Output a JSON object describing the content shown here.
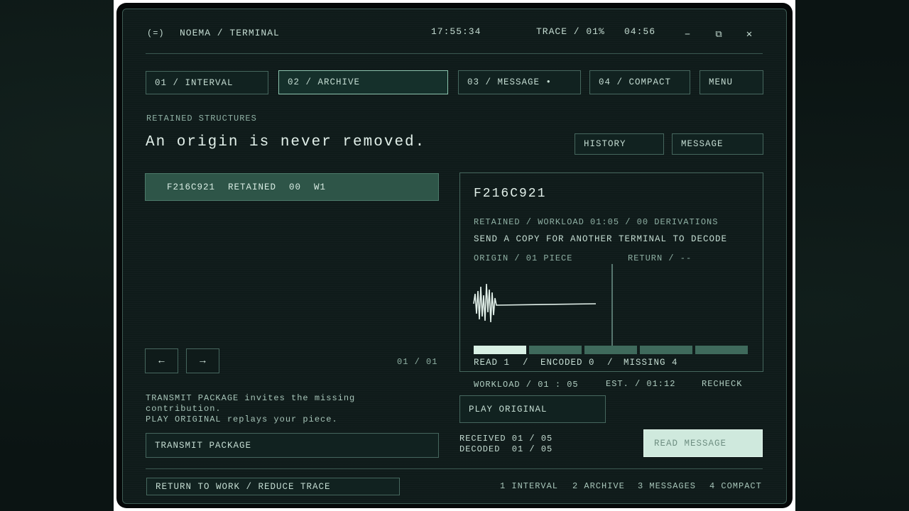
{
  "window": {
    "icon_glyph": "(=)",
    "title": "NOEMA / TERMINAL",
    "clock": "17:55:34",
    "trace": "TRACE / 01%",
    "timer": "04:56",
    "minimize_glyph": "–",
    "restore_glyph": "⧉",
    "close_glyph": "✕"
  },
  "tabs": [
    {
      "label": "01 / INTERVAL",
      "active": false
    },
    {
      "label": "02 / ARCHIVE",
      "active": true
    },
    {
      "label": "03 / MESSAGE •",
      "active": false
    },
    {
      "label": "04 / COMPACT",
      "active": false
    }
  ],
  "menu_label": "MENU",
  "section_label": "RETAINED STRUCTURES",
  "headline": "An origin is never removed.",
  "history_label": "HISTORY",
  "message_label": "MESSAGE",
  "list": {
    "items": [
      {
        "id": "F216C921",
        "status": "RETAINED",
        "count": "00",
        "slot": "W1"
      }
    ],
    "prev_glyph": "←",
    "next_glyph": "→",
    "page": "01 / 01"
  },
  "detail": {
    "id": "F216C921",
    "meta": "RETAINED / WORKLOAD 01:05 / 00 DERIVATIONS",
    "instruction": "SEND A COPY FOR ANOTHER TERMINAL TO DECODE",
    "origin_label": "ORIGIN / 01 PIECE",
    "return_label": "RETURN / --",
    "progress_segments": [
      "read",
      "encoded",
      "missing",
      "missing",
      "missing"
    ],
    "read_stat": "READ 1",
    "encoded_stat": "ENCODED 0",
    "missing_stat": "MISSING 4",
    "sep": "/"
  },
  "workload": {
    "workload": "WORKLOAD / 01 : 05",
    "est": "EST. / 01:12",
    "recheck": "RECHECK"
  },
  "help": {
    "line1": "TRANSMIT PACKAGE invites the missing",
    "line2": "contribution.",
    "line3": "PLAY ORIGINAL replays your piece."
  },
  "play_original_label": "PLAY ORIGINAL",
  "transmit_label": "TRANSMIT PACKAGE",
  "received": "RECEIVED 01 / 05",
  "decoded": "DECODED  01 / 05",
  "read_message_label": "READ MESSAGE",
  "footer": {
    "return_label": "RETURN TO WORK / REDUCE TRACE",
    "links": [
      "1 INTERVAL",
      "2 ARCHIVE",
      "3 MESSAGES",
      "4 COMPACT"
    ]
  },
  "colors": {
    "accent_light": "#cfe9dd",
    "accent_row": "#2e5548",
    "segment_read": "#d8f0e4",
    "segment_other": "#3f6a5c"
  }
}
